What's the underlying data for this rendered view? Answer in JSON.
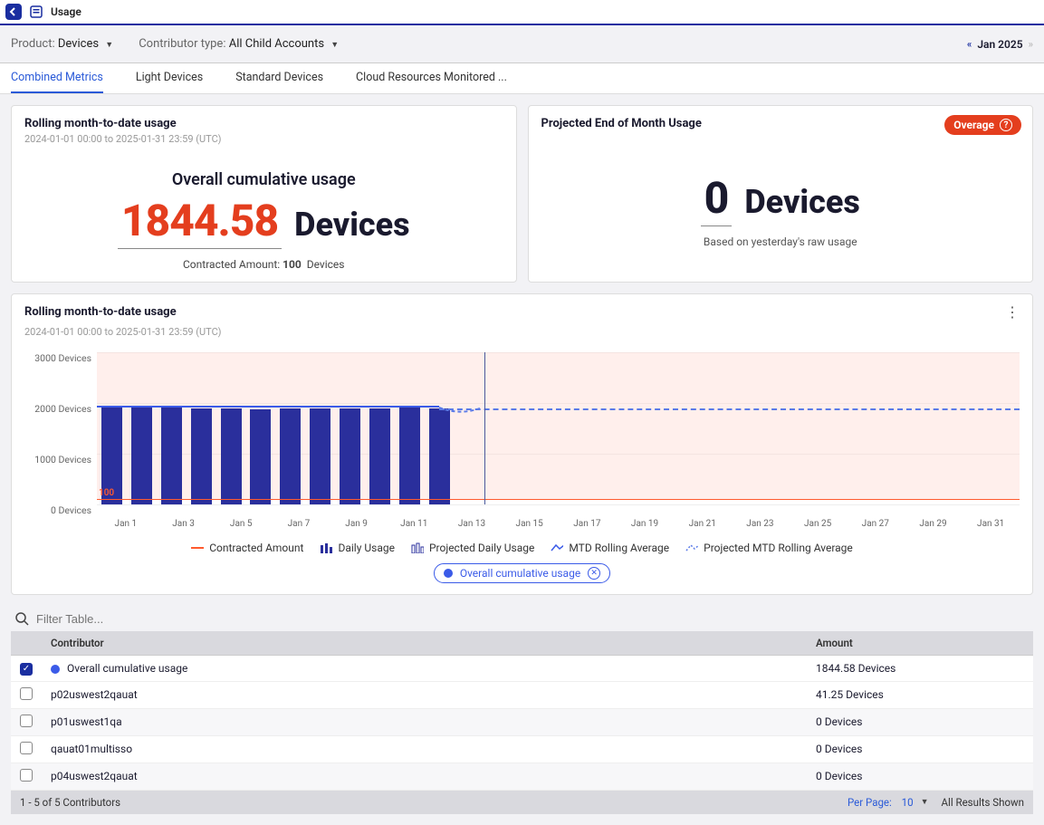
{
  "header": {
    "title": "Usage"
  },
  "filters": {
    "product_label": "Product:",
    "product_value": "Devices",
    "contributor_label": "Contributor type:",
    "contributor_value": "All Child Accounts",
    "date_display": "Jan 2025"
  },
  "tabs": [
    {
      "label": "Combined Metrics",
      "active": true
    },
    {
      "label": "Light Devices",
      "active": false
    },
    {
      "label": "Standard Devices",
      "active": false
    },
    {
      "label": "Cloud Resources Monitored ...",
      "active": false
    }
  ],
  "cards": {
    "rolling": {
      "title": "Rolling month-to-date usage",
      "subtitle": "2024-01-01 00:00 to 2025-01-31 23:59 (UTC)",
      "metric_title": "Overall cumulative usage",
      "value": "1844.58",
      "unit": "Devices",
      "contracted_label": "Contracted Amount:",
      "contracted_amount": "100",
      "contracted_unit": "Devices"
    },
    "projected": {
      "title": "Projected End of Month Usage",
      "overage_label": "Overage",
      "value": "0",
      "unit": "Devices",
      "caption": "Based on yesterday's raw usage"
    }
  },
  "chart": {
    "title": "Rolling month-to-date usage",
    "subtitle": "2024-01-01 00:00 to 2025-01-31 23:59 (UTC)",
    "y_ticks": [
      "3000 Devices",
      "2000 Devices",
      "1000 Devices",
      "0 Devices"
    ],
    "x_ticks": [
      "Jan 1",
      "Jan 3",
      "Jan 5",
      "Jan 7",
      "Jan 9",
      "Jan 11",
      "Jan 13",
      "Jan 15",
      "Jan 17",
      "Jan 19",
      "Jan 21",
      "Jan 23",
      "Jan 25",
      "Jan 27",
      "Jan 29",
      "Jan 31"
    ],
    "contracted_line_label": "100",
    "legend": {
      "contracted": "Contracted Amount",
      "daily": "Daily Usage",
      "proj_daily": "Projected Daily Usage",
      "mtd": "MTD Rolling Average",
      "proj_mtd": "Projected MTD Rolling Average",
      "chip": "Overall cumulative usage"
    }
  },
  "chart_data": {
    "type": "bar",
    "title": "Rolling month-to-date usage",
    "ylabel": "Devices",
    "ylim": [
      0,
      3000
    ],
    "contracted_amount": 100,
    "today_marker_index": 13,
    "x": [
      "Jan 1",
      "Jan 2",
      "Jan 3",
      "Jan 4",
      "Jan 5",
      "Jan 6",
      "Jan 7",
      "Jan 8",
      "Jan 9",
      "Jan 10",
      "Jan 11",
      "Jan 12",
      "Jan 13",
      "Jan 14",
      "Jan 15",
      "Jan 16",
      "Jan 17",
      "Jan 18",
      "Jan 19",
      "Jan 20",
      "Jan 21",
      "Jan 22",
      "Jan 23",
      "Jan 24",
      "Jan 25",
      "Jan 26",
      "Jan 27",
      "Jan 28",
      "Jan 29",
      "Jan 30",
      "Jan 31"
    ],
    "series": [
      {
        "name": "Daily Usage",
        "values": [
          1950,
          1920,
          1950,
          1900,
          1900,
          1880,
          1900,
          1900,
          1900,
          1900,
          1950,
          1900,
          null,
          null,
          null,
          null,
          null,
          null,
          null,
          null,
          null,
          null,
          null,
          null,
          null,
          null,
          null,
          null,
          null,
          null,
          null
        ]
      },
      {
        "name": "Projected Daily Usage",
        "values": [
          null,
          null,
          null,
          null,
          null,
          null,
          null,
          null,
          null,
          null,
          null,
          null,
          null,
          0,
          0,
          0,
          0,
          0,
          0,
          0,
          0,
          0,
          0,
          0,
          0,
          0,
          0,
          0,
          0,
          0,
          0
        ]
      },
      {
        "name": "MTD Rolling Average",
        "values": [
          1950,
          1935,
          1940,
          1930,
          1924,
          1916,
          1914,
          1912,
          1911,
          1910,
          1913,
          1912,
          null,
          null,
          null,
          null,
          null,
          null,
          null,
          null,
          null,
          null,
          null,
          null,
          null,
          null,
          null,
          null,
          null,
          null,
          null
        ]
      },
      {
        "name": "Projected MTD Rolling Average",
        "values": [
          null,
          null,
          null,
          null,
          null,
          null,
          null,
          null,
          null,
          null,
          null,
          1912,
          1750,
          1900,
          1900,
          1900,
          1900,
          1900,
          1900,
          1900,
          1900,
          1900,
          1900,
          1900,
          1900,
          1900,
          1900,
          1900,
          1900,
          1900,
          1900
        ]
      },
      {
        "name": "Contracted Amount",
        "values": [
          100,
          100,
          100,
          100,
          100,
          100,
          100,
          100,
          100,
          100,
          100,
          100,
          100,
          100,
          100,
          100,
          100,
          100,
          100,
          100,
          100,
          100,
          100,
          100,
          100,
          100,
          100,
          100,
          100,
          100,
          100
        ]
      }
    ]
  },
  "table": {
    "filter_placeholder": "Filter Table...",
    "columns": {
      "contributor": "Contributor",
      "amount": "Amount"
    },
    "rows": [
      {
        "checked": true,
        "dot": true,
        "name": "Overall cumulative usage",
        "amount": "1844.58 Devices"
      },
      {
        "checked": false,
        "dot": false,
        "name": "p02uswest2qauat",
        "amount": "41.25 Devices"
      },
      {
        "checked": false,
        "dot": false,
        "name": "p01uswest1qa",
        "amount": "0 Devices"
      },
      {
        "checked": false,
        "dot": false,
        "name": "qauat01multisso",
        "amount": "0 Devices"
      },
      {
        "checked": false,
        "dot": false,
        "name": "p04uswest2qauat",
        "amount": "0 Devices"
      }
    ],
    "footer": {
      "range": "1 - 5 of 5 Contributors",
      "per_page_label": "Per Page:",
      "per_page_value": "10",
      "all_shown": "All Results Shown"
    }
  }
}
